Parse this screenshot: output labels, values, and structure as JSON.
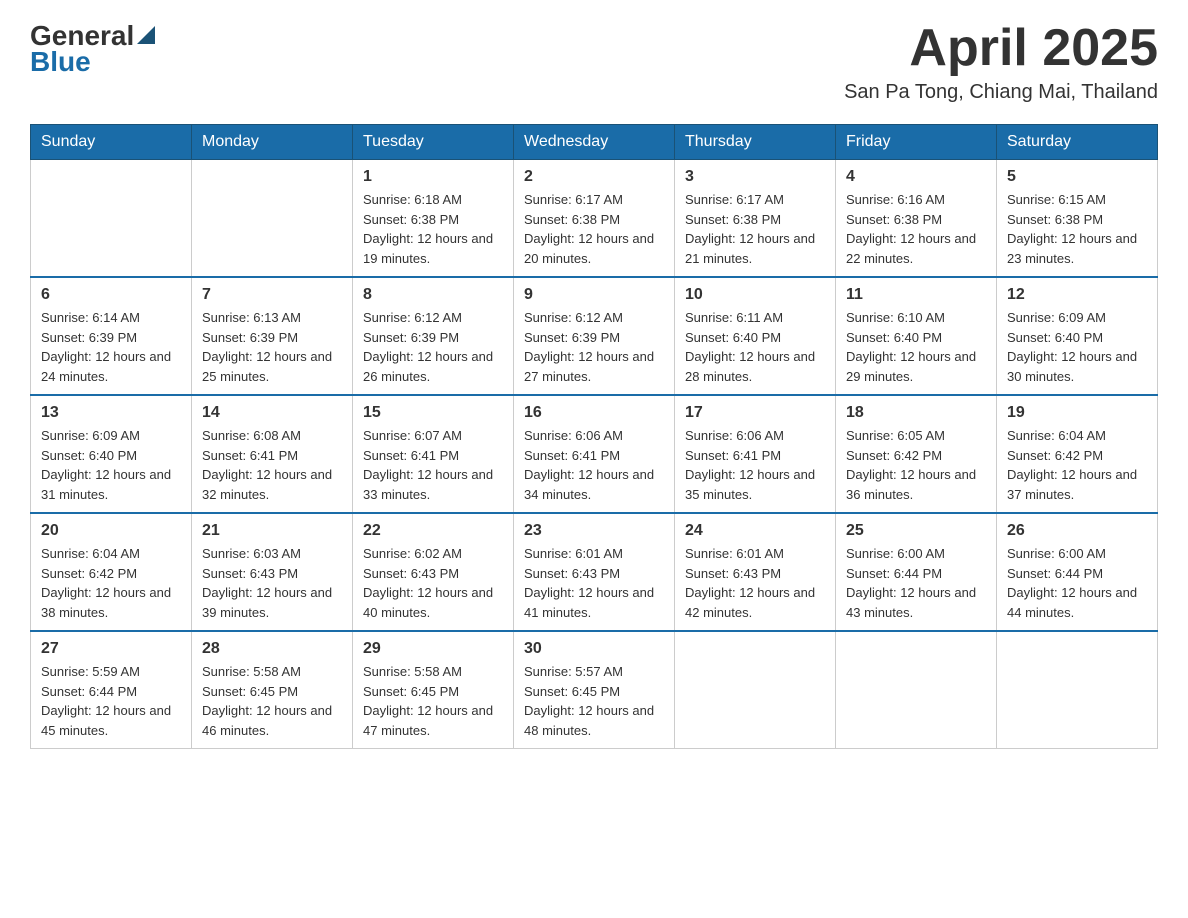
{
  "header": {
    "logo_general": "General",
    "logo_blue": "Blue",
    "month_year": "April 2025",
    "location": "San Pa Tong, Chiang Mai, Thailand"
  },
  "days_of_week": [
    "Sunday",
    "Monday",
    "Tuesday",
    "Wednesday",
    "Thursday",
    "Friday",
    "Saturday"
  ],
  "weeks": [
    [
      {
        "day": "",
        "sunrise": "",
        "sunset": "",
        "daylight": ""
      },
      {
        "day": "",
        "sunrise": "",
        "sunset": "",
        "daylight": ""
      },
      {
        "day": "1",
        "sunrise": "Sunrise: 6:18 AM",
        "sunset": "Sunset: 6:38 PM",
        "daylight": "Daylight: 12 hours and 19 minutes."
      },
      {
        "day": "2",
        "sunrise": "Sunrise: 6:17 AM",
        "sunset": "Sunset: 6:38 PM",
        "daylight": "Daylight: 12 hours and 20 minutes."
      },
      {
        "day": "3",
        "sunrise": "Sunrise: 6:17 AM",
        "sunset": "Sunset: 6:38 PM",
        "daylight": "Daylight: 12 hours and 21 minutes."
      },
      {
        "day": "4",
        "sunrise": "Sunrise: 6:16 AM",
        "sunset": "Sunset: 6:38 PM",
        "daylight": "Daylight: 12 hours and 22 minutes."
      },
      {
        "day": "5",
        "sunrise": "Sunrise: 6:15 AM",
        "sunset": "Sunset: 6:38 PM",
        "daylight": "Daylight: 12 hours and 23 minutes."
      }
    ],
    [
      {
        "day": "6",
        "sunrise": "Sunrise: 6:14 AM",
        "sunset": "Sunset: 6:39 PM",
        "daylight": "Daylight: 12 hours and 24 minutes."
      },
      {
        "day": "7",
        "sunrise": "Sunrise: 6:13 AM",
        "sunset": "Sunset: 6:39 PM",
        "daylight": "Daylight: 12 hours and 25 minutes."
      },
      {
        "day": "8",
        "sunrise": "Sunrise: 6:12 AM",
        "sunset": "Sunset: 6:39 PM",
        "daylight": "Daylight: 12 hours and 26 minutes."
      },
      {
        "day": "9",
        "sunrise": "Sunrise: 6:12 AM",
        "sunset": "Sunset: 6:39 PM",
        "daylight": "Daylight: 12 hours and 27 minutes."
      },
      {
        "day": "10",
        "sunrise": "Sunrise: 6:11 AM",
        "sunset": "Sunset: 6:40 PM",
        "daylight": "Daylight: 12 hours and 28 minutes."
      },
      {
        "day": "11",
        "sunrise": "Sunrise: 6:10 AM",
        "sunset": "Sunset: 6:40 PM",
        "daylight": "Daylight: 12 hours and 29 minutes."
      },
      {
        "day": "12",
        "sunrise": "Sunrise: 6:09 AM",
        "sunset": "Sunset: 6:40 PM",
        "daylight": "Daylight: 12 hours and 30 minutes."
      }
    ],
    [
      {
        "day": "13",
        "sunrise": "Sunrise: 6:09 AM",
        "sunset": "Sunset: 6:40 PM",
        "daylight": "Daylight: 12 hours and 31 minutes."
      },
      {
        "day": "14",
        "sunrise": "Sunrise: 6:08 AM",
        "sunset": "Sunset: 6:41 PM",
        "daylight": "Daylight: 12 hours and 32 minutes."
      },
      {
        "day": "15",
        "sunrise": "Sunrise: 6:07 AM",
        "sunset": "Sunset: 6:41 PM",
        "daylight": "Daylight: 12 hours and 33 minutes."
      },
      {
        "day": "16",
        "sunrise": "Sunrise: 6:06 AM",
        "sunset": "Sunset: 6:41 PM",
        "daylight": "Daylight: 12 hours and 34 minutes."
      },
      {
        "day": "17",
        "sunrise": "Sunrise: 6:06 AM",
        "sunset": "Sunset: 6:41 PM",
        "daylight": "Daylight: 12 hours and 35 minutes."
      },
      {
        "day": "18",
        "sunrise": "Sunrise: 6:05 AM",
        "sunset": "Sunset: 6:42 PM",
        "daylight": "Daylight: 12 hours and 36 minutes."
      },
      {
        "day": "19",
        "sunrise": "Sunrise: 6:04 AM",
        "sunset": "Sunset: 6:42 PM",
        "daylight": "Daylight: 12 hours and 37 minutes."
      }
    ],
    [
      {
        "day": "20",
        "sunrise": "Sunrise: 6:04 AM",
        "sunset": "Sunset: 6:42 PM",
        "daylight": "Daylight: 12 hours and 38 minutes."
      },
      {
        "day": "21",
        "sunrise": "Sunrise: 6:03 AM",
        "sunset": "Sunset: 6:43 PM",
        "daylight": "Daylight: 12 hours and 39 minutes."
      },
      {
        "day": "22",
        "sunrise": "Sunrise: 6:02 AM",
        "sunset": "Sunset: 6:43 PM",
        "daylight": "Daylight: 12 hours and 40 minutes."
      },
      {
        "day": "23",
        "sunrise": "Sunrise: 6:01 AM",
        "sunset": "Sunset: 6:43 PM",
        "daylight": "Daylight: 12 hours and 41 minutes."
      },
      {
        "day": "24",
        "sunrise": "Sunrise: 6:01 AM",
        "sunset": "Sunset: 6:43 PM",
        "daylight": "Daylight: 12 hours and 42 minutes."
      },
      {
        "day": "25",
        "sunrise": "Sunrise: 6:00 AM",
        "sunset": "Sunset: 6:44 PM",
        "daylight": "Daylight: 12 hours and 43 minutes."
      },
      {
        "day": "26",
        "sunrise": "Sunrise: 6:00 AM",
        "sunset": "Sunset: 6:44 PM",
        "daylight": "Daylight: 12 hours and 44 minutes."
      }
    ],
    [
      {
        "day": "27",
        "sunrise": "Sunrise: 5:59 AM",
        "sunset": "Sunset: 6:44 PM",
        "daylight": "Daylight: 12 hours and 45 minutes."
      },
      {
        "day": "28",
        "sunrise": "Sunrise: 5:58 AM",
        "sunset": "Sunset: 6:45 PM",
        "daylight": "Daylight: 12 hours and 46 minutes."
      },
      {
        "day": "29",
        "sunrise": "Sunrise: 5:58 AM",
        "sunset": "Sunset: 6:45 PM",
        "daylight": "Daylight: 12 hours and 47 minutes."
      },
      {
        "day": "30",
        "sunrise": "Sunrise: 5:57 AM",
        "sunset": "Sunset: 6:45 PM",
        "daylight": "Daylight: 12 hours and 48 minutes."
      },
      {
        "day": "",
        "sunrise": "",
        "sunset": "",
        "daylight": ""
      },
      {
        "day": "",
        "sunrise": "",
        "sunset": "",
        "daylight": ""
      },
      {
        "day": "",
        "sunrise": "",
        "sunset": "",
        "daylight": ""
      }
    ]
  ]
}
